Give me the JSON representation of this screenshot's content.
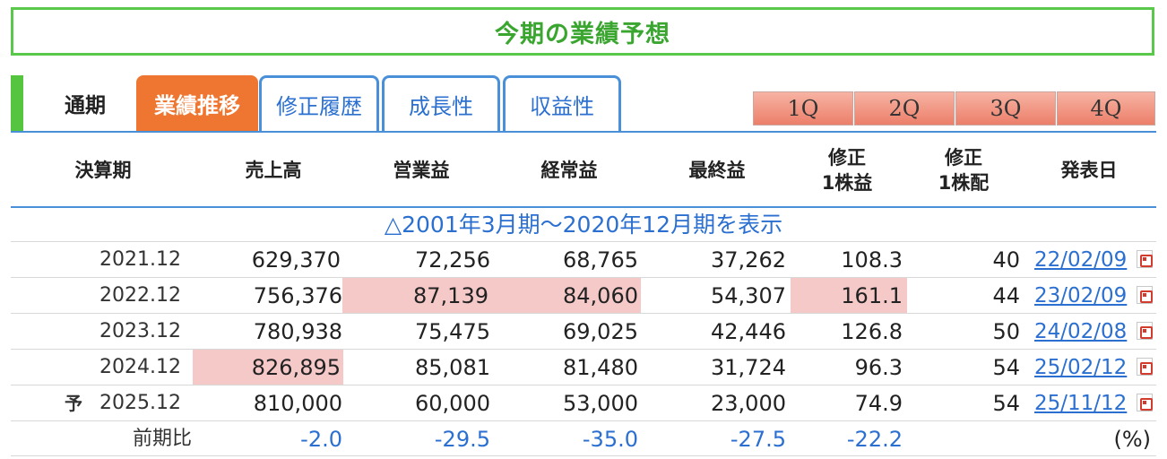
{
  "title": "今期の業績予想",
  "tabs": {
    "plain": "通期",
    "active": "業績推移",
    "links": [
      "修正履歴",
      "成長性",
      "収益性"
    ]
  },
  "quarters": [
    "1Q",
    "2Q",
    "3Q",
    "4Q"
  ],
  "headers": {
    "period": "決算期",
    "sales": "売上高",
    "operating": "営業益",
    "ordinary": "経常益",
    "net": "最終益",
    "eps_line1": "修正",
    "eps_line2": "1株益",
    "dps_line1": "修正",
    "dps_line2": "1株配",
    "date": "発表日"
  },
  "history_link": "△2001年3月期～2020年12月期を表示",
  "rows": [
    {
      "period": "2021.12",
      "sales": "629,370",
      "operating": "72,256",
      "ordinary": "68,765",
      "net": "37,262",
      "eps": "108.3",
      "dps": "40",
      "date": "22/02/09"
    },
    {
      "period": "2022.12",
      "sales": "756,376",
      "operating": "87,139",
      "ordinary": "84,060",
      "net": "54,307",
      "eps": "161.1",
      "dps": "44",
      "date": "23/02/09"
    },
    {
      "period": "2023.12",
      "sales": "780,938",
      "operating": "75,475",
      "ordinary": "69,025",
      "net": "42,446",
      "eps": "126.8",
      "dps": "50",
      "date": "24/02/08"
    },
    {
      "period": "2024.12",
      "sales": "826,895",
      "operating": "85,081",
      "ordinary": "81,480",
      "net": "31,724",
      "eps": "96.3",
      "dps": "54",
      "date": "25/02/12"
    },
    {
      "period": "2025.12",
      "forecast_mark": "予",
      "sales": "810,000",
      "operating": "60,000",
      "ordinary": "53,000",
      "net": "23,000",
      "eps": "74.9",
      "dps": "54",
      "date": "25/11/12"
    }
  ],
  "comparison": {
    "label": "前期比",
    "sales": "-2.0",
    "operating": "-29.5",
    "ordinary": "-35.0",
    "net": "-27.5",
    "eps": "-22.2",
    "unit": "(%)"
  },
  "colors": {
    "title_green": "#3aa630",
    "tab_active": "#ef7630",
    "link_blue": "#2b6fd0",
    "highlight": "#f6c9c9"
  }
}
